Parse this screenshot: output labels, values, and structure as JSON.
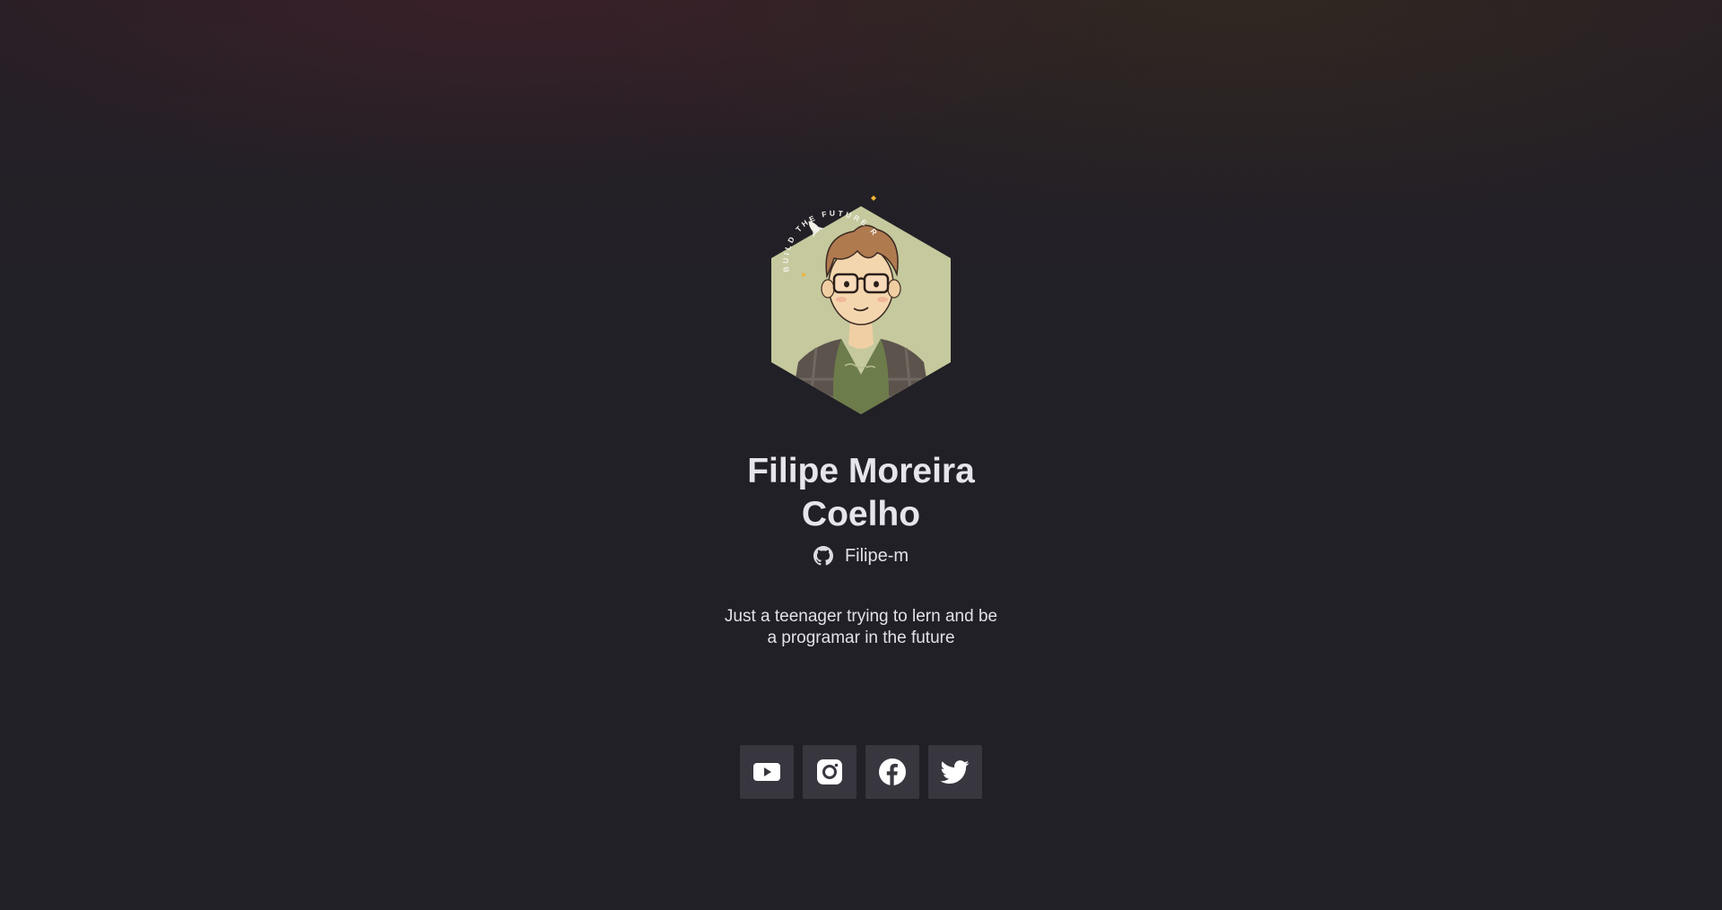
{
  "profile": {
    "name": "Filipe Moreira Coelho",
    "github_handle": "Filipe-m",
    "bio": "Just a teenager trying to lern and be a programar in the future",
    "badge_text": "BUILD THE FUTURE ROCKET",
    "avatar_bg_color": "#c5c99d",
    "icon": "github-icon"
  },
  "socials": [
    {
      "name": "youtube",
      "icon": "youtube-icon"
    },
    {
      "name": "instagram",
      "icon": "instagram-icon"
    },
    {
      "name": "facebook",
      "icon": "facebook-icon"
    },
    {
      "name": "twitter",
      "icon": "twitter-icon"
    }
  ],
  "colors": {
    "background": "#212026",
    "text": "#e4e3ea",
    "button_bg": "#38373f",
    "accent": "#f2b431"
  }
}
